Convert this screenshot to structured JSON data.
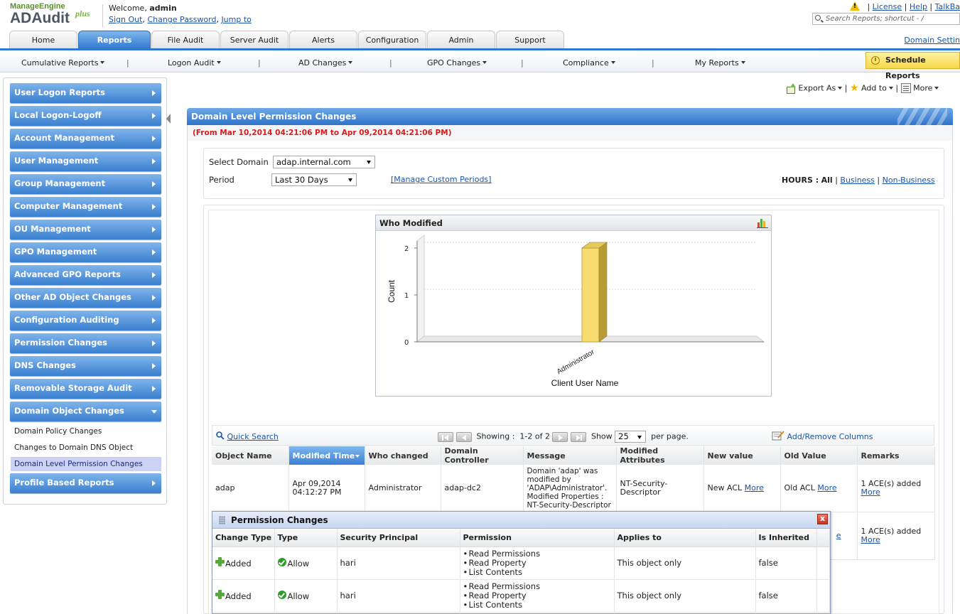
{
  "header": {
    "logo_brand": "ManageEngine",
    "logo_product": "ADAudit",
    "logo_plus": "plus",
    "welcome_prefix": "Welcome,",
    "username": "admin",
    "sign_out": "Sign Out",
    "change_password": "Change Password",
    "jump_to": "Jump to",
    "license": "License",
    "help": "Help",
    "talkback": "TalkBa",
    "search_placeholder": "Search Reports; shortcut - /",
    "domain_settings": "Domain Settin"
  },
  "tabs": [
    {
      "label": "Home"
    },
    {
      "label": "Reports",
      "active": true
    },
    {
      "label": "File Audit"
    },
    {
      "label": "Server Audit"
    },
    {
      "label": "Alerts"
    },
    {
      "label": "Configuration"
    },
    {
      "label": "Admin"
    },
    {
      "label": "Support"
    }
  ],
  "subnav": {
    "items": [
      "Cumulative Reports",
      "Logon Audit",
      "AD Changes",
      "GPO Changes",
      "Compliance",
      "My Reports"
    ],
    "separator": "|",
    "schedule_reports": "Schedule Reports"
  },
  "sidebar": {
    "items": [
      "User Logon Reports",
      "Local Logon-Logoff",
      "Account Management",
      "User Management",
      "Group Management",
      "Computer Management",
      "OU Management",
      "GPO Management",
      "Advanced GPO Reports",
      "Other AD Object Changes",
      "Configuration Auditing",
      "Permission Changes",
      "DNS Changes",
      "Removable Storage Audit",
      "Domain Object Changes"
    ],
    "subitems": [
      "Domain Policy Changes",
      "Changes to Domain DNS Object",
      "Domain Level Permission Changes"
    ],
    "last_item": "Profile Based Reports"
  },
  "actions": {
    "export": "Export As",
    "add_to": "Add to",
    "more": "More",
    "separator": "|"
  },
  "report": {
    "title": "Domain Level Permission Changes",
    "date_range": "(From Mar 10,2014 04:21:06 PM to Apr 09,2014 04:21:06 PM)",
    "select_domain_label": "Select Domain",
    "domain_value": "adap.internal.com",
    "period_label": "Period",
    "period_value": "Last 30 Days",
    "manage_periods": "[Manage Custom Periods]",
    "hours_label": "HOURS :",
    "hours_all": "All",
    "hours_business": "Business",
    "hours_nonbusiness": "Non-Business",
    "separator": "|"
  },
  "chart_data": {
    "type": "bar",
    "title": "Who Modified",
    "categories": [
      "Administrator"
    ],
    "values": [
      2
    ],
    "xlabel": "Client User Name",
    "ylabel": "Count",
    "ylim": [
      0,
      2
    ],
    "yticks": [
      "0",
      "1",
      "2"
    ],
    "bar_color": "#f7dc6f",
    "grid": true
  },
  "table": {
    "quick_search": "Quick Search",
    "showing_label": "Showing :",
    "range": "1-2 of 2",
    "show_label": "Show",
    "page_size": "25",
    "per_page": "per page.",
    "add_remove_columns": "Add/Remove Columns",
    "columns": [
      "Object Name",
      "Modified Time",
      "Who changed",
      "Domain Controller",
      "Message",
      "Modified Attributes",
      "New value",
      "Old Value",
      "Remarks"
    ],
    "rows": [
      {
        "object_name": "adap",
        "modified_time": "Apr 09,2014 04:12:27 PM",
        "who_changed": "Administrator",
        "domain_controller": "adap-dc2",
        "message": "Domain 'adap' was modified by 'ADAP\\Administrator'. Modified Properties : NT-Security-Descriptor",
        "modified_attributes": "NT-Security-Descriptor",
        "new_value": "New ACL",
        "new_value_link": "More",
        "old_value": "Old ACL",
        "old_value_link": "More",
        "remarks": "1 ACE(s) added",
        "remarks_link": "More"
      },
      {
        "old_value_link_partial": "e",
        "remarks": "1 ACE(s) added",
        "remarks_link": "More"
      }
    ]
  },
  "popup": {
    "title": "Permission Changes",
    "close": "x",
    "columns": [
      "Change Type",
      "Type",
      "Security Principal",
      "Permission",
      "Applies to",
      "Is Inherited"
    ],
    "rows": [
      {
        "change_type": "Added",
        "type": "Allow",
        "principal": "hari",
        "permissions": [
          "Read Permissions",
          "Read Property",
          "List Contents"
        ],
        "applies_to": "This object only",
        "inherited": "false"
      },
      {
        "change_type": "Added",
        "type": "Allow",
        "principal": "hari",
        "permissions": [
          "Read Permissions",
          "Read Property",
          "List Contents"
        ],
        "applies_to": "This object only",
        "inherited": "false"
      }
    ]
  }
}
